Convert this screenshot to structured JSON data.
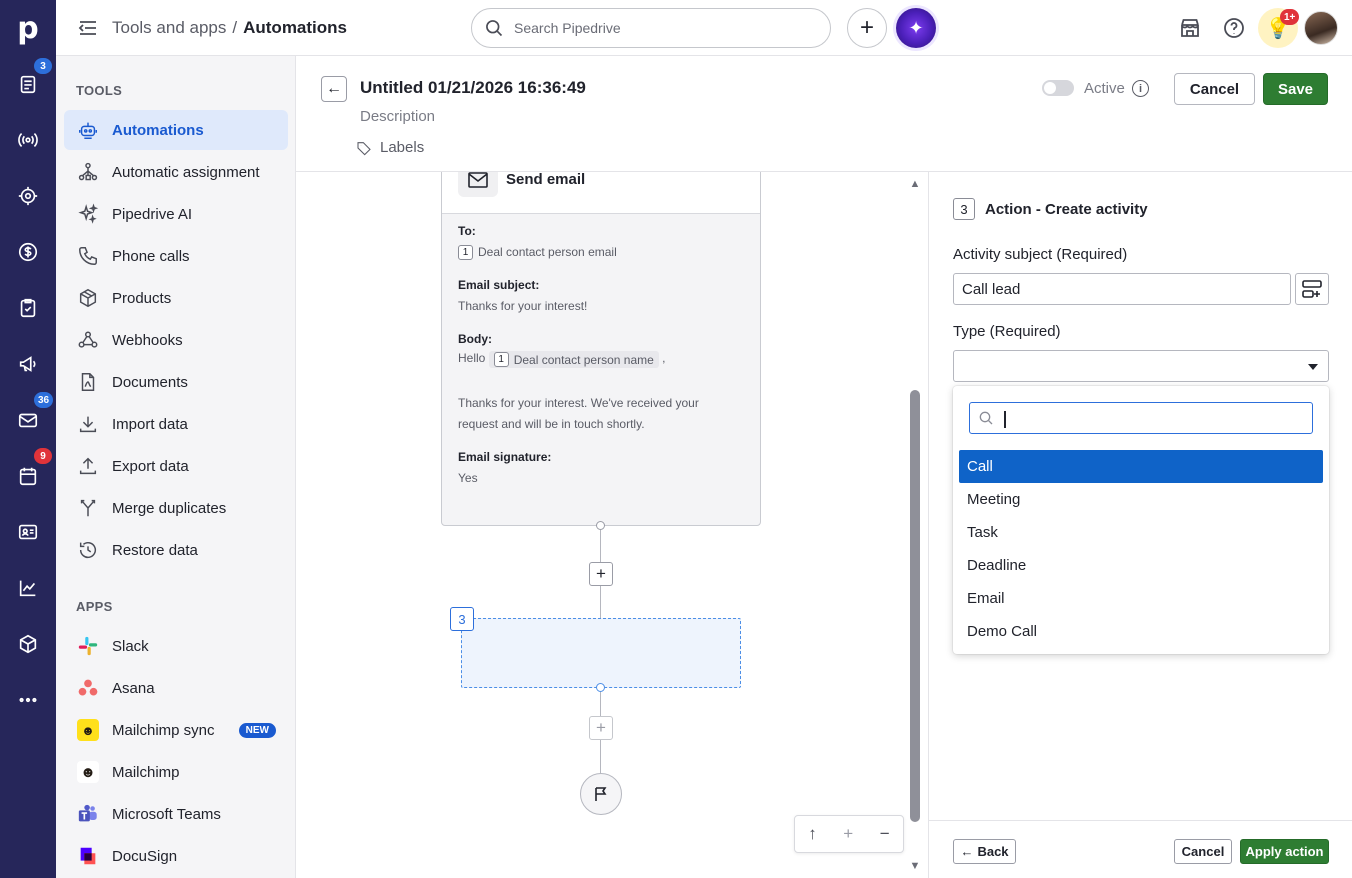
{
  "rail": {
    "logo": "p",
    "badges": {
      "leads": "3",
      "mail": "36",
      "calendar": "9"
    }
  },
  "topbar": {
    "breadcrumb_parent": "Tools and apps",
    "breadcrumb_sep": "/",
    "breadcrumb_current": "Automations",
    "search_placeholder": "Search Pipedrive",
    "notification_badge": "1+"
  },
  "sidebar": {
    "tools_heading": "TOOLS",
    "tools": [
      {
        "label": "Automations",
        "icon": "robot-icon",
        "active": true
      },
      {
        "label": "Automatic assignment",
        "icon": "hierarchy-icon"
      },
      {
        "label": "Pipedrive AI",
        "icon": "sparkle-icon"
      },
      {
        "label": "Phone calls",
        "icon": "phone-icon"
      },
      {
        "label": "Products",
        "icon": "box-icon"
      },
      {
        "label": "Webhooks",
        "icon": "webhook-icon"
      },
      {
        "label": "Documents",
        "icon": "document-icon"
      },
      {
        "label": "Import data",
        "icon": "download-icon"
      },
      {
        "label": "Export data",
        "icon": "upload-icon"
      },
      {
        "label": "Merge duplicates",
        "icon": "merge-icon"
      },
      {
        "label": "Restore data",
        "icon": "restore-icon"
      }
    ],
    "apps_heading": "APPS",
    "apps": [
      {
        "label": "Slack",
        "icon": "slack-logo"
      },
      {
        "label": "Asana",
        "icon": "asana-logo"
      },
      {
        "label": "Mailchimp sync",
        "icon": "mailchimp-logo",
        "badge": "NEW"
      },
      {
        "label": "Mailchimp",
        "icon": "mailchimp-logo"
      },
      {
        "label": "Microsoft Teams",
        "icon": "teams-logo"
      },
      {
        "label": "DocuSign",
        "icon": "docusign-logo"
      }
    ]
  },
  "header": {
    "title": "Untitled 01/21/2026 16:36:49",
    "description": "Description",
    "labels": "Labels",
    "active_label": "Active",
    "cancel": "Cancel",
    "save": "Save"
  },
  "canvas": {
    "email_card": {
      "title": "Send email",
      "to_label": "To:",
      "to_step": "1",
      "to_value": "Deal contact person email",
      "subject_label": "Email subject:",
      "subject_value": "Thanks for your interest!",
      "body_label": "Body:",
      "body_hello": "Hello",
      "body_step": "1",
      "body_token": "Deal contact person name",
      "body_comma": ",",
      "body_line1": "Thanks for your interest. We've received your",
      "body_line2": "request and will be in touch shortly.",
      "signature_label": "Email signature:",
      "signature_value": "Yes"
    },
    "placeholder_step": "3"
  },
  "panel": {
    "step": "3",
    "title": "Action - Create activity",
    "subject_label": "Activity subject (Required)",
    "subject_value": "Call lead",
    "type_label": "Type (Required)",
    "options": [
      "Call",
      "Meeting",
      "Task",
      "Deadline",
      "Email",
      "Demo Call"
    ],
    "selected_option": "Call",
    "back": "Back",
    "cancel": "Cancel",
    "apply": "Apply action"
  }
}
